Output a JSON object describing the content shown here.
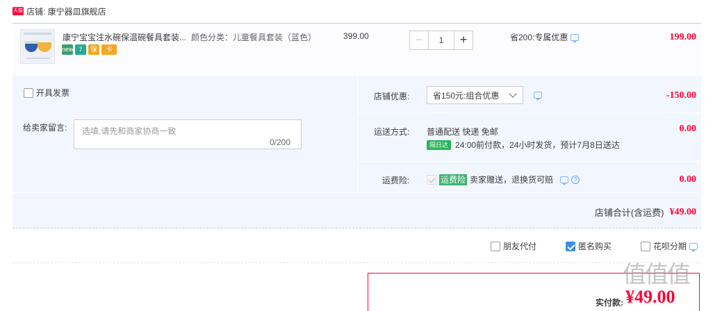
{
  "shop": {
    "badge": "天猫",
    "name": "店铺: 康宁器皿旗舰店"
  },
  "item": {
    "title": "康宁宝宝注水碗保温碗餐具套装...",
    "sku": "颜色分类：儿童餐具套装（蓝色）",
    "service_icons": [
      {
        "icon": "new-icon",
        "text": "new"
      },
      {
        "icon": "seven-day-return-icon",
        "text": "7"
      },
      {
        "icon": "guarantee-icon",
        "text": "保"
      },
      {
        "icon": "card-icon",
        "text": "卡"
      }
    ],
    "unit_price": "399.00",
    "quantity": "1",
    "minus_label": "−",
    "plus_label": "+",
    "promo": "省200:专属优惠",
    "total": "199.00"
  },
  "invoice": {
    "label": "开具发票"
  },
  "message": {
    "label": "给卖家留言:",
    "placeholder": "选填,请先和商家协商一致",
    "count": "0/200"
  },
  "coupon": {
    "label": "店铺优惠:",
    "selected": "省150元:组合优惠",
    "amount": "-150.00"
  },
  "shipping": {
    "label": "运送方式:",
    "method": "普通配送 快递 免邮",
    "badge": "隔日达",
    "desc": "24:00前付款，24小时发货，预计7月8日送达",
    "amount": "0.00"
  },
  "insurance": {
    "label": "运费险:",
    "badge": "运费险",
    "desc": "卖家赠送，退换货可赔",
    "amount": "0.00"
  },
  "store_total": {
    "label": "店铺合计(含运费)",
    "amount": "¥49.00"
  },
  "options": {
    "friend_pay": "朋友代付",
    "anonymous": "匿名购买",
    "huabei": "花呗分期"
  },
  "payment": {
    "label": "实付款:",
    "amount": "¥49.00"
  },
  "watermark": "值值值",
  "colors": {
    "accent_red": "#ff0036",
    "border_blue": "#b2d1ff",
    "panel_bg": "#f2f7ff",
    "check_blue": "#3d8ee8"
  }
}
